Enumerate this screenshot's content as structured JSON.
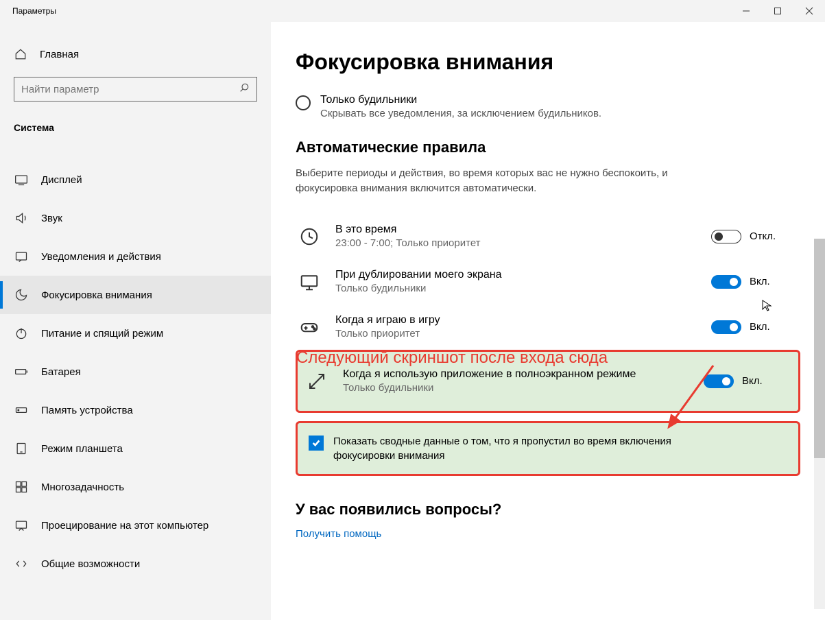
{
  "window": {
    "title": "Параметры"
  },
  "sidebar": {
    "home": "Главная",
    "search_placeholder": "Найти параметр",
    "category": "Система",
    "items": [
      {
        "label": "Дисплей"
      },
      {
        "label": "Звук"
      },
      {
        "label": "Уведомления и действия"
      },
      {
        "label": "Фокусировка внимания"
      },
      {
        "label": "Питание и спящий режим"
      },
      {
        "label": "Батарея"
      },
      {
        "label": "Память устройства"
      },
      {
        "label": "Режим планшета"
      },
      {
        "label": "Многозадачность"
      },
      {
        "label": "Проецирование на этот компьютер"
      },
      {
        "label": "Общие возможности"
      }
    ]
  },
  "main": {
    "title": "Фокусировка внимания",
    "radio": {
      "title": "Только будильники",
      "desc": "Скрывать все уведомления, за исключением будильников."
    },
    "rules_heading": "Автоматические правила",
    "rules_desc": "Выберите периоды и действия, во время которых вас не нужно беспокоить, и фокусировка внимания включится автоматически.",
    "rules": [
      {
        "title": "В это время",
        "sub": "23:00 - 7:00; Только приоритет",
        "state": "Откл.",
        "on": false
      },
      {
        "title": "При дублировании моего экрана",
        "sub": "Только будильники",
        "state": "Вкл.",
        "on": true
      },
      {
        "title": "Когда я играю в игру",
        "sub": "Только приоритет",
        "state": "Вкл.",
        "on": true
      },
      {
        "title": "Когда я использую приложение в полноэкранном режиме",
        "sub": "Только будильники",
        "state": "Вкл.",
        "on": true
      }
    ],
    "checkbox_label": "Показать сводные данные о том, что я пропустил во время включения фокусировки внимания",
    "questions_heading": "У вас появились вопросы?",
    "help_link": "Получить помощь"
  },
  "annotation": {
    "text": "Следующий скриншот после входа сюда"
  }
}
